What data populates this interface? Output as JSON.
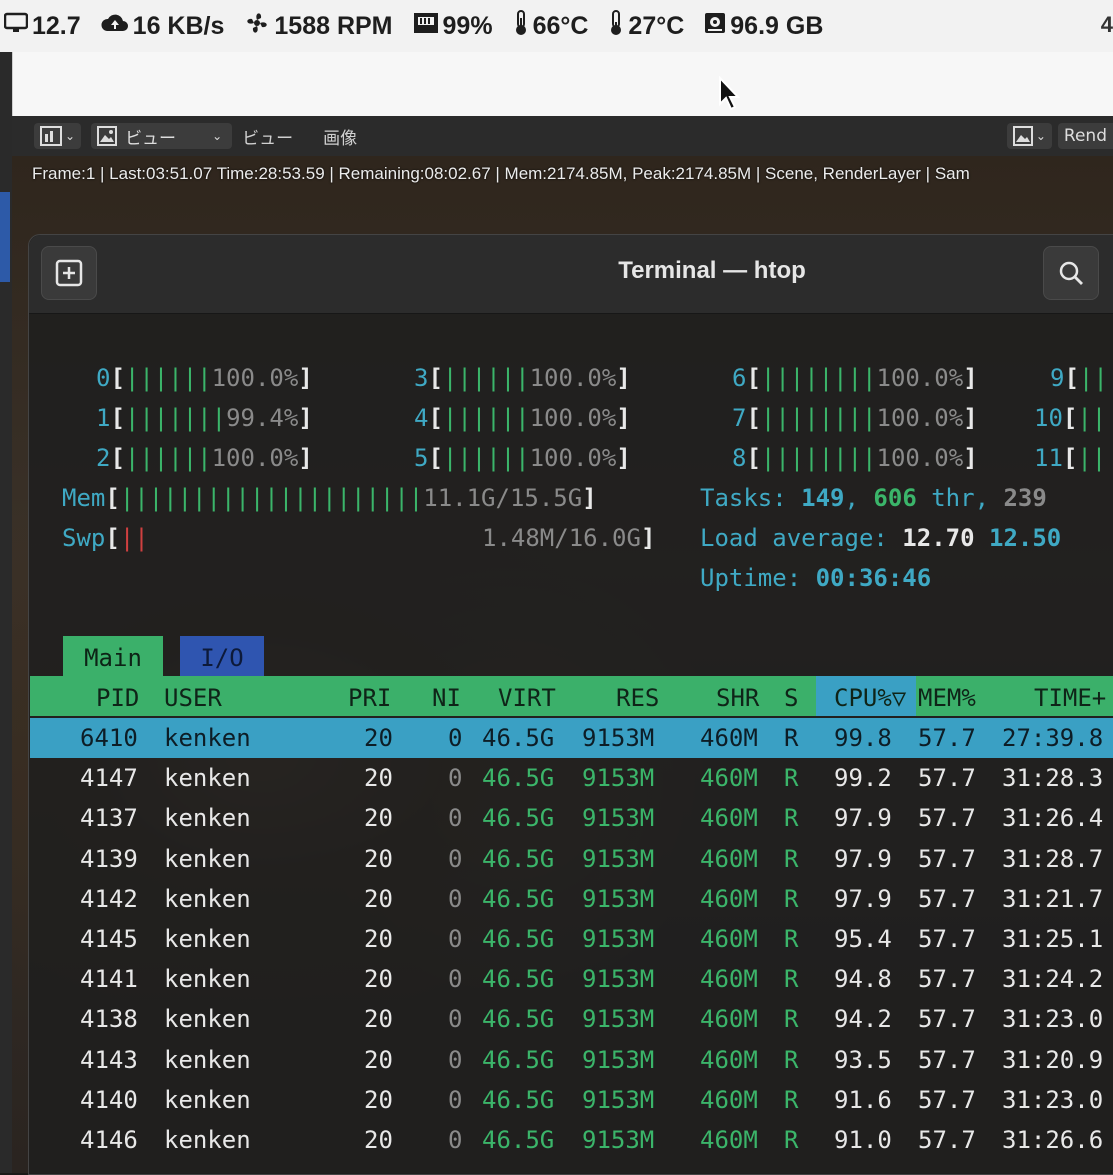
{
  "status_bar": {
    "items": [
      {
        "icon": "monitor-icon",
        "value": "12.7"
      },
      {
        "icon": "cloud-upload-icon",
        "value": "16 KB/s"
      },
      {
        "icon": "fan-icon",
        "value": "1588 RPM"
      },
      {
        "icon": "memory-chip-icon",
        "value": "99%"
      },
      {
        "icon": "thermometer-icon",
        "value": "66°C"
      },
      {
        "icon": "thermometer-icon",
        "value": "27°C"
      },
      {
        "icon": "disk-icon",
        "value": "96.9 GB"
      }
    ],
    "edge_value": "4"
  },
  "blender": {
    "view_button": "ビュー",
    "menu_view": "ビュー",
    "menu_image": "画像",
    "right_label": "Rend",
    "frame_info": "Frame:1 | Last:03:51.07 Time:28:53.59 | Remaining:08:02.67 | Mem:2174.85M, Peak:2174.85M | Scene, RenderLayer | Sam"
  },
  "terminal": {
    "title": "Terminal — htop"
  },
  "htop": {
    "cpus": [
      {
        "id": "0",
        "bars": "||||||",
        "pct": "100.0%"
      },
      {
        "id": "1",
        "bars": "|||||||",
        "pct": "99.4%"
      },
      {
        "id": "2",
        "bars": "||||||",
        "pct": "100.0%"
      },
      {
        "id": "3",
        "bars": "||||||",
        "pct": "100.0%"
      },
      {
        "id": "4",
        "bars": "||||||",
        "pct": "100.0%"
      },
      {
        "id": "5",
        "bars": "||||||",
        "pct": "100.0%"
      },
      {
        "id": "6",
        "bars": "||||||||",
        "pct": "100.0%"
      },
      {
        "id": "7",
        "bars": "||||||||",
        "pct": "100.0%"
      },
      {
        "id": "8",
        "bars": "||||||||",
        "pct": "100.0%"
      },
      {
        "id": "9",
        "bars": "||",
        "pct": ""
      },
      {
        "id": "10",
        "bars": "||",
        "pct": ""
      },
      {
        "id": "11",
        "bars": "||",
        "pct": ""
      }
    ],
    "mem": {
      "label": "Mem",
      "bars": "|||||||||||||||||||||",
      "used": "11.1G",
      "total": "/15.5G"
    },
    "swp": {
      "label": "Swp",
      "bars": "||",
      "value": "1.48M/16.0G"
    },
    "tasks": {
      "label": "Tasks:",
      "count": "149",
      "threads": "606",
      "thr_label": "thr,",
      "running": "239"
    },
    "load": {
      "label": "Load average:",
      "v1": "12.70",
      "v2": "12.50"
    },
    "uptime": {
      "label": "Uptime:",
      "value": "00:36:46"
    },
    "tabs": [
      "Main",
      "I/O"
    ],
    "columns": [
      "PID",
      "USER",
      "PRI",
      "NI",
      "VIRT",
      "RES",
      "SHR",
      "S",
      "CPU%▽",
      "MEM%",
      "TIME+"
    ],
    "processes": [
      {
        "pid": "6410",
        "user": "kenken",
        "pri": "20",
        "ni": "0",
        "virt": "46.5G",
        "res": "9153M",
        "shr": "460M",
        "s": "R",
        "cpu": "99.8",
        "mem": "57.7",
        "time": "27:39.8"
      },
      {
        "pid": "4147",
        "user": "kenken",
        "pri": "20",
        "ni": "0",
        "virt": "46.5G",
        "res": "9153M",
        "shr": "460M",
        "s": "R",
        "cpu": "99.2",
        "mem": "57.7",
        "time": "31:28.3"
      },
      {
        "pid": "4137",
        "user": "kenken",
        "pri": "20",
        "ni": "0",
        "virt": "46.5G",
        "res": "9153M",
        "shr": "460M",
        "s": "R",
        "cpu": "97.9",
        "mem": "57.7",
        "time": "31:26.4"
      },
      {
        "pid": "4139",
        "user": "kenken",
        "pri": "20",
        "ni": "0",
        "virt": "46.5G",
        "res": "9153M",
        "shr": "460M",
        "s": "R",
        "cpu": "97.9",
        "mem": "57.7",
        "time": "31:28.7"
      },
      {
        "pid": "4142",
        "user": "kenken",
        "pri": "20",
        "ni": "0",
        "virt": "46.5G",
        "res": "9153M",
        "shr": "460M",
        "s": "R",
        "cpu": "97.9",
        "mem": "57.7",
        "time": "31:21.7"
      },
      {
        "pid": "4145",
        "user": "kenken",
        "pri": "20",
        "ni": "0",
        "virt": "46.5G",
        "res": "9153M",
        "shr": "460M",
        "s": "R",
        "cpu": "95.4",
        "mem": "57.7",
        "time": "31:25.1"
      },
      {
        "pid": "4141",
        "user": "kenken",
        "pri": "20",
        "ni": "0",
        "virt": "46.5G",
        "res": "9153M",
        "shr": "460M",
        "s": "R",
        "cpu": "94.8",
        "mem": "57.7",
        "time": "31:24.2"
      },
      {
        "pid": "4138",
        "user": "kenken",
        "pri": "20",
        "ni": "0",
        "virt": "46.5G",
        "res": "9153M",
        "shr": "460M",
        "s": "R",
        "cpu": "94.2",
        "mem": "57.7",
        "time": "31:23.0"
      },
      {
        "pid": "4143",
        "user": "kenken",
        "pri": "20",
        "ni": "0",
        "virt": "46.5G",
        "res": "9153M",
        "shr": "460M",
        "s": "R",
        "cpu": "93.5",
        "mem": "57.7",
        "time": "31:20.9"
      },
      {
        "pid": "4140",
        "user": "kenken",
        "pri": "20",
        "ni": "0",
        "virt": "46.5G",
        "res": "9153M",
        "shr": "460M",
        "s": "R",
        "cpu": "91.6",
        "mem": "57.7",
        "time": "31:23.0"
      },
      {
        "pid": "4146",
        "user": "kenken",
        "pri": "20",
        "ni": "0",
        "virt": "46.5G",
        "res": "9153M",
        "shr": "460M",
        "s": "R",
        "cpu": "91.0",
        "mem": "57.7",
        "time": "31:26.6"
      }
    ]
  },
  "colors": {
    "cyan": "#3fa9c4",
    "green": "#3bb56a",
    "selection": "#3aa0c4",
    "header_green": "#3bb06a",
    "io_tab_blue": "#2f55b0"
  }
}
